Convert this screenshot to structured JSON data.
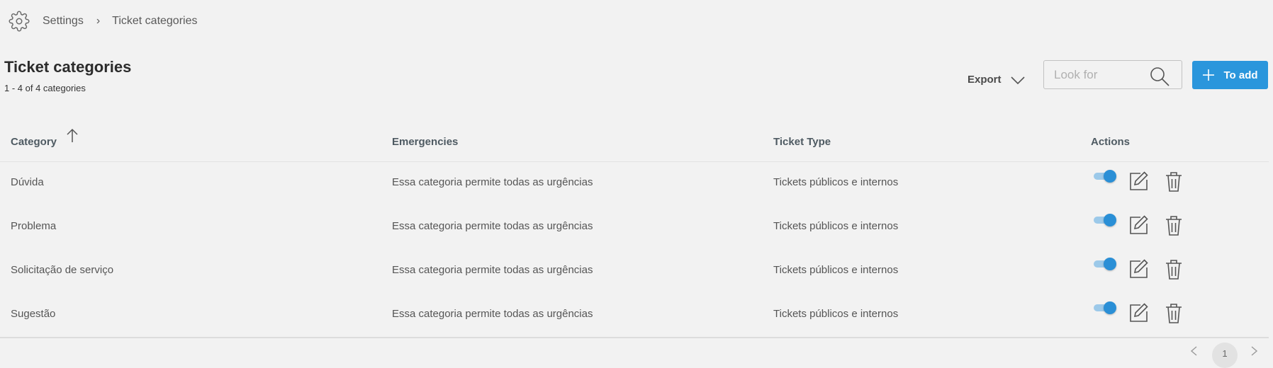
{
  "breadcrumb": {
    "icon": "gear-icon",
    "items": [
      "Settings",
      "Ticket categories"
    ],
    "separator": "›"
  },
  "page": {
    "title": "Ticket categories",
    "count": "1 - 4 of 4 categories"
  },
  "toolbar": {
    "export_label": "Export",
    "search_placeholder": "Look for",
    "search_value": "",
    "add_label": "To add"
  },
  "table": {
    "columns": [
      "Category",
      "Emergencies",
      "Ticket Type",
      "Actions"
    ],
    "sort": {
      "column": "Category",
      "direction": "ascending",
      "icon": "arrow-up-icon"
    },
    "rows": [
      {
        "category": "Dúvida",
        "emergencies": "Essa categoria permite todas as urgências",
        "ticket_type": "Tickets públicos e internos",
        "enabled": true
      },
      {
        "category": "Problema",
        "emergencies": "Essa categoria permite todas as urgências",
        "ticket_type": "Tickets públicos e internos",
        "enabled": true
      },
      {
        "category": "Solicitação de serviço",
        "emergencies": "Essa categoria permite todas as urgências",
        "ticket_type": "Tickets públicos e internos",
        "enabled": true
      },
      {
        "category": "Sugestão",
        "emergencies": "Essa categoria permite todas as urgências",
        "ticket_type": "Tickets públicos e internos",
        "enabled": true
      }
    ]
  },
  "pagination": {
    "current_page": "1"
  },
  "colors": {
    "accent": "#2a96dc",
    "background": "#f2f2f2",
    "header_text": "#4e5a62",
    "toggle_on": "#2a8fd6"
  }
}
